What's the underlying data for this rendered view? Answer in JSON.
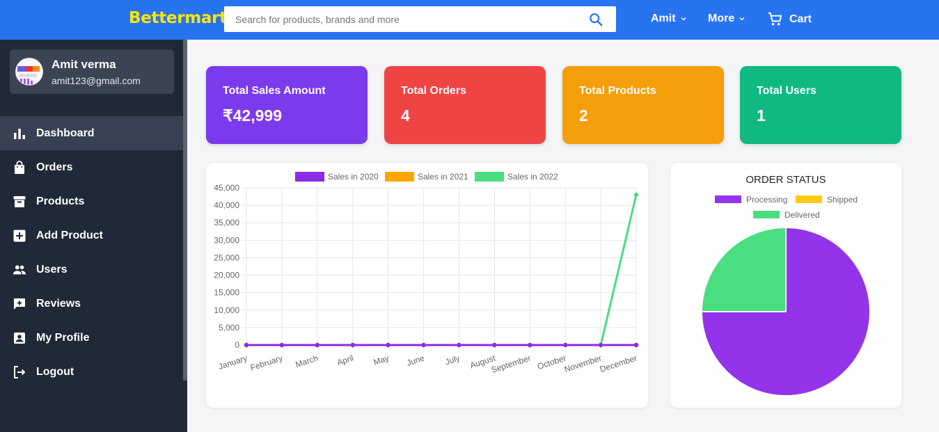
{
  "navbar": {
    "brand": "Bettermart",
    "search_placeholder": "Search for products, brands and more",
    "user_label": "Amit",
    "more_label": "More",
    "cart_label": "Cart"
  },
  "sidebar": {
    "profile": {
      "name": "Amit verma",
      "email": "amit123@gmail.com"
    },
    "items": [
      {
        "label": "Dashboard",
        "icon": "bar-chart-icon",
        "active": true
      },
      {
        "label": "Orders",
        "icon": "shopping-bag-icon",
        "active": false
      },
      {
        "label": "Products",
        "icon": "archive-box-icon",
        "active": false
      },
      {
        "label": "Add Product",
        "icon": "plus-box-icon",
        "active": false
      },
      {
        "label": "Users",
        "icon": "users-icon",
        "active": false
      },
      {
        "label": "Reviews",
        "icon": "review-icon",
        "active": false
      },
      {
        "label": "My Profile",
        "icon": "profile-icon",
        "active": false
      },
      {
        "label": "Logout",
        "icon": "logout-icon",
        "active": false
      }
    ]
  },
  "cards": [
    {
      "title": "Total Sales Amount",
      "value": "₹42,999",
      "color": "#7c3aed"
    },
    {
      "title": "Total Orders",
      "value": "4",
      "color": "#ef4444"
    },
    {
      "title": "Total Products",
      "value": "2",
      "color": "#f59e0b"
    },
    {
      "title": "Total Users",
      "value": "1",
      "color": "#10b981"
    }
  ],
  "chart_data": [
    {
      "type": "line",
      "title": "",
      "xlabel": "",
      "ylabel": "",
      "categories": [
        "January",
        "February",
        "March",
        "April",
        "May",
        "June",
        "July",
        "August",
        "September",
        "October",
        "November",
        "December"
      ],
      "series": [
        {
          "name": "Sales in 2020",
          "color": "#8b2be2",
          "values": [
            0,
            0,
            0,
            0,
            0,
            0,
            0,
            0,
            0,
            0,
            0,
            0
          ]
        },
        {
          "name": "Sales in 2021",
          "color": "#ffa500",
          "values": [
            0,
            0,
            0,
            0,
            0,
            0,
            0,
            0,
            0,
            0,
            0,
            0
          ]
        },
        {
          "name": "Sales in 2022",
          "color": "#4ade80",
          "values": [
            0,
            0,
            0,
            0,
            0,
            0,
            0,
            0,
            0,
            0,
            0,
            42999
          ]
        }
      ],
      "ylim": [
        0,
        45000
      ],
      "yticks": [
        "45,000",
        "40,000",
        "35,000",
        "30,000",
        "25,000",
        "20,000",
        "15,000",
        "10,000",
        "5,000",
        "0"
      ],
      "grid": true,
      "legend": "top"
    },
    {
      "type": "pie",
      "title": "ORDER STATUS",
      "labels": [
        "Processing",
        "Shipped",
        "Delivered"
      ],
      "colors": [
        "#9333ea",
        "#facc15",
        "#4ade80"
      ],
      "values": [
        3,
        0,
        1
      ],
      "legend": "top"
    }
  ]
}
